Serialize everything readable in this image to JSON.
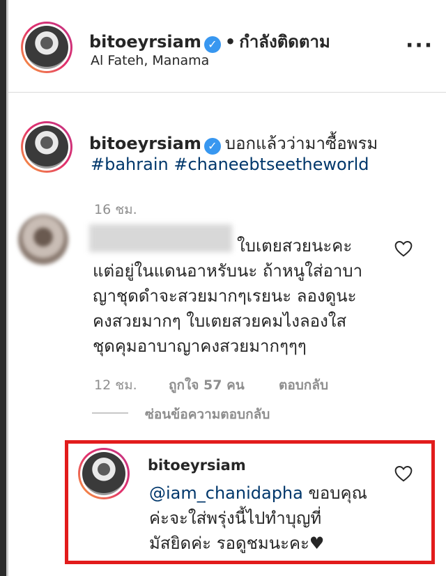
{
  "header": {
    "username": "bitoeyrsiam",
    "separator": "•",
    "following_label": "กำลังติดตาม",
    "location": "Al Fateh, Manama",
    "more": "···"
  },
  "caption": {
    "username": "bitoeyrsiam",
    "text": "บอกแล้วว่ามาซื้อพรม",
    "hashtags": [
      "#bahrain",
      "#chaneebtseetheworld"
    ],
    "time": "16 ชม."
  },
  "comment": {
    "lines": [
      "ใบเตยสวยนะคะ",
      "แต่อยู่ในแดนอาหรับนะ ถ้าหนูใส่อาบา",
      "ญาชุดดำจะสวยมากๆเรยนะ ลองดูนะ",
      "คงสวยมากๆ ใบเตยสวยคมไงลองใส",
      "ชุดคุมอาบาญาคงสวยมากๆๆๆ"
    ],
    "time": "12 ชม.",
    "likes": "ถูกใจ 57 คน",
    "reply": "ตอบกลับ",
    "hide_replies": "ซ่อนข้อความตอบกลับ"
  },
  "reply_comment": {
    "username": "bitoeyrsiam",
    "mention": "@iam_chanidapha",
    "line1_rest": " ขอบคุณ",
    "line2": "ค่ะจะใส่พรุ่งนี้ไปทำบุญที่",
    "line3": "มัสยิดค่ะ รอดูชมนะคะ♥"
  },
  "icons": {
    "verified": "✓",
    "heart": "heart-outline-icon"
  },
  "colors": {
    "highlight": "#e21c1c",
    "link": "#00376b",
    "verified": "#3897f0",
    "muted": "#8e8e8e"
  }
}
